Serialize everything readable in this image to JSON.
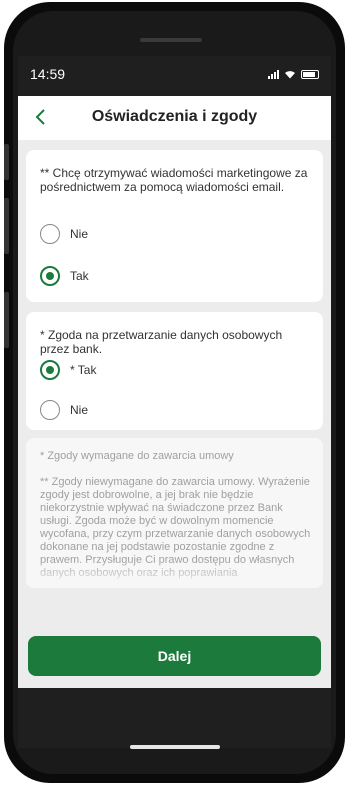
{
  "status": {
    "time": "14:59"
  },
  "appbar": {
    "back_icon": "chevron-left-icon",
    "title": "Oświadczenia i zgody"
  },
  "card_marketing": {
    "text": "** Chcę otrzymywać wiadomości marketingowe za pośrednictwem za pomocą wiadomości email.",
    "options": [
      {
        "label": "Nie",
        "selected": false
      },
      {
        "label": "Tak",
        "selected": true
      }
    ]
  },
  "card_data": {
    "text": "* Zgoda na przetwarzanie danych osobowych przez bank.",
    "options": [
      {
        "label": "* Tak",
        "selected": true
      },
      {
        "label": "Nie",
        "selected": false
      }
    ]
  },
  "info": {
    "required_note": "* Zgody wymagane do zawarcia umowy",
    "optional_note": "** Zgody niewymagane do zawarcia umowy. Wyrażenie zgody jest dobrowolne, a jej brak nie będzie niekorzystnie wpływać na świadczone przez Bank usługi. Zgoda może być w dowolnym momencie wycofana, przy czym przetwarzanie danych osobowych dokonane na jej podstawie pozostanie zgodne z prawem. Przysługuje Ci prawo dostępu do własnych danych osobowych oraz ich poprawiania"
  },
  "footer": {
    "next_label": "Dalej"
  },
  "colors": {
    "accent": "#1b7a3c",
    "background": "#ececec"
  }
}
